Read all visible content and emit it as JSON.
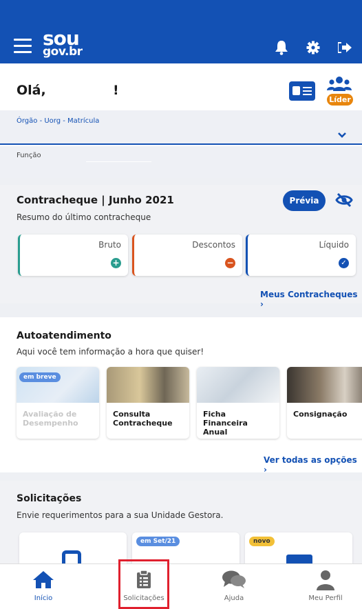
{
  "app": {
    "logo_line1": "sou",
    "logo_line2": "gov.br"
  },
  "header": {
    "greeting": "Olá,",
    "greeting_suffix": "!",
    "leader_badge": "Líder",
    "field_orgao_label": "Órgão - Uorg - Matrícula",
    "field_funcao_label": "Função"
  },
  "contracheque": {
    "title": "Contracheque | Junho 2021",
    "subtitle": "Resumo do último contracheque",
    "preview_button": "Prévia",
    "cards": [
      {
        "label": "Bruto",
        "icon": "plus-circle-icon",
        "color": "#2a9d8f"
      },
      {
        "label": "Descontos",
        "icon": "minus-circle-icon",
        "color": "#d9541e"
      },
      {
        "label": "Líquido",
        "icon": "check-circle-icon",
        "color": "#1351b4"
      }
    ],
    "link": "Meus Contracheques"
  },
  "autoatendimento": {
    "title": "Autoatendimento",
    "subtitle": "Aqui você tem informação a hora que quiser!",
    "tiles": [
      {
        "label": "Avaliação de Desempenho",
        "badge": "em breve",
        "disabled": true
      },
      {
        "label": "Consulta Contracheque"
      },
      {
        "label": "Ficha Financeira Anual"
      },
      {
        "label": "Consignação"
      }
    ],
    "link": "Ver todas as opções"
  },
  "solicitacoes": {
    "title": "Solicitações",
    "subtitle": "Envie requerimentos para a sua Unidade Gestora.",
    "badges": [
      "em Set/21",
      "novo"
    ]
  },
  "nav": {
    "items": [
      {
        "label": "Início",
        "icon": "home-icon"
      },
      {
        "label": "Solicitações",
        "icon": "clipboard-icon"
      },
      {
        "label": "Ajuda",
        "icon": "chat-icon"
      },
      {
        "label": "Meu Perfil",
        "icon": "user-icon"
      }
    ]
  },
  "colors": {
    "primary": "#1351b4",
    "accent_orange": "#e8860e",
    "highlight": "#e0202e"
  }
}
